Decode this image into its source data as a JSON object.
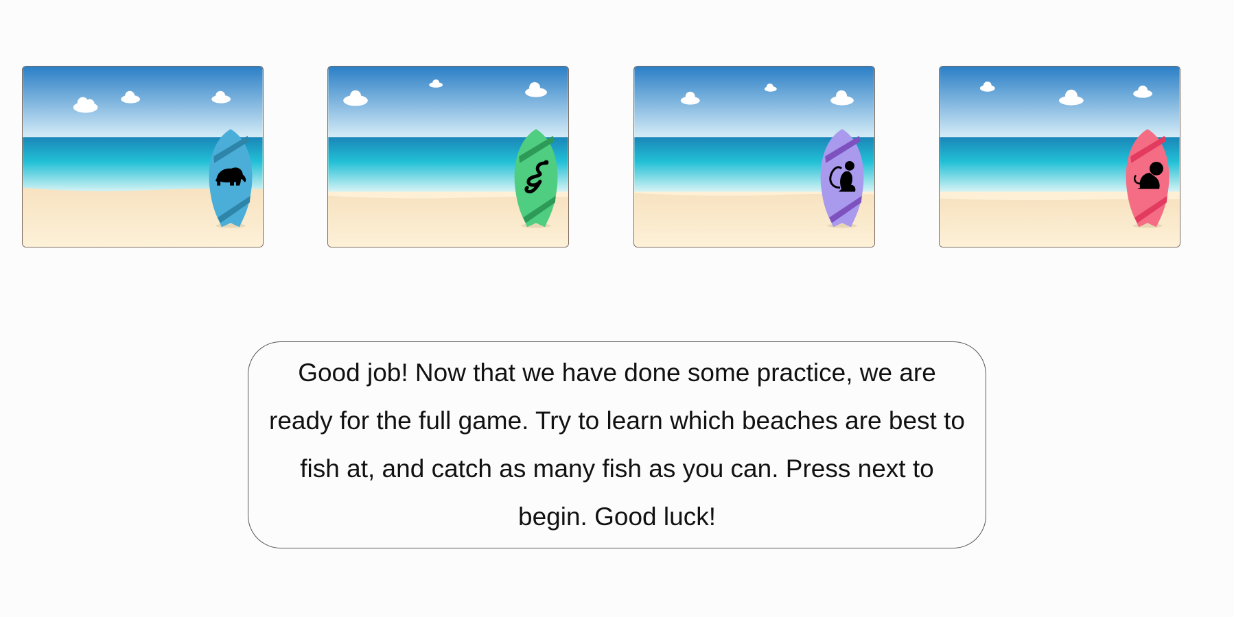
{
  "beaches": [
    {
      "board_animal": "elephant",
      "board_icon": "elephant-icon",
      "board_color": "#4aaed8",
      "stripe_color": "#2d86a9"
    },
    {
      "board_animal": "snake",
      "board_icon": "snake-icon",
      "board_color": "#4fcd80",
      "stripe_color": "#2d9a58"
    },
    {
      "board_animal": "monkey",
      "board_icon": "monkey-icon",
      "board_color": "#a99aee",
      "stripe_color": "#7d52bf"
    },
    {
      "board_animal": "lion",
      "board_icon": "lion-icon",
      "board_color": "#f46d84",
      "stripe_color": "#e23b5f"
    }
  ],
  "message": {
    "text": "Good job! Now that we have done some practice, we are ready for the full game. Try to learn which beaches are best to fish at, and catch as many fish as you can. Press next to begin. Good luck!"
  },
  "colors": {
    "sky_top": "#2b82c9",
    "sky_bottom": "#d9f0fa",
    "sea": "#1fb7cf",
    "sand": "#fdf0d6",
    "box_border": "#555555"
  }
}
